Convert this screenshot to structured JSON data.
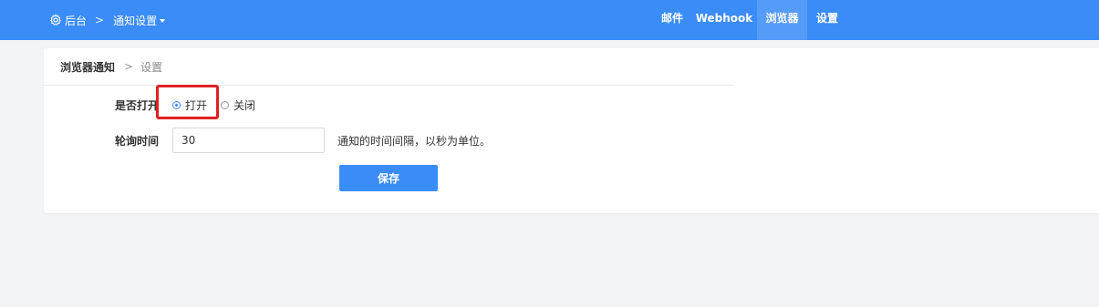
{
  "header": {
    "breadcrumb": {
      "home_label": "后台",
      "separator": ">",
      "current_label": "通知设置"
    },
    "nav": [
      {
        "label": "邮件",
        "active": false
      },
      {
        "label": "Webhook",
        "active": false
      },
      {
        "label": "浏览器",
        "active": true
      },
      {
        "label": "设置",
        "active": false
      }
    ],
    "colors": {
      "bar": "#3a8cf7",
      "text": "#ffffff"
    }
  },
  "panel": {
    "title": "浏览器通知",
    "arrow": ">",
    "subtitle": "设置",
    "form": {
      "enable": {
        "label": "是否打开",
        "options": [
          {
            "label": "打开",
            "checked": true
          },
          {
            "label": "关闭",
            "checked": false
          }
        ]
      },
      "interval": {
        "label": "轮询时间",
        "value": "30",
        "hint": "通知的时间间隔，以秒为单位。"
      },
      "save_label": "保存"
    }
  },
  "icons": {
    "home": "gear-icon",
    "breadcrumb_separator": "chevron-right-icon",
    "dropdown": "caret-down-icon",
    "radio": "radio-icon"
  }
}
